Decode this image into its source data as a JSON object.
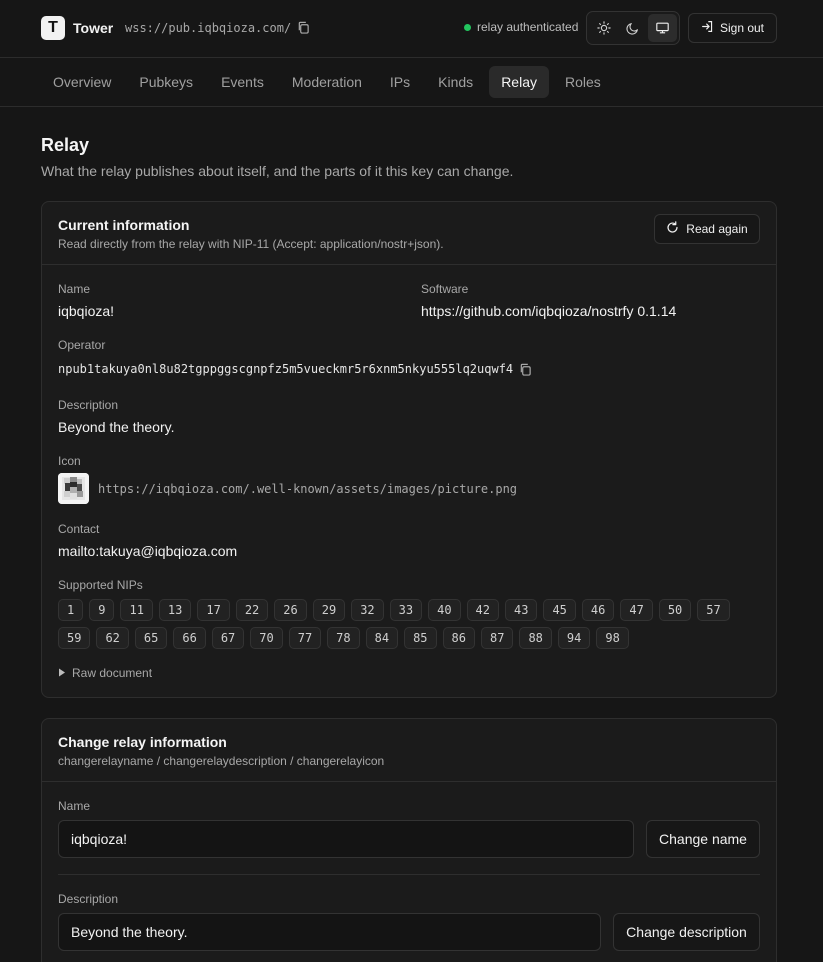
{
  "header": {
    "logo_glyph": "T",
    "app_name": "Tower",
    "relay_url": "wss://pub.iqbqioza.com/",
    "status_text": "relay authenticated",
    "status_color": "#22c55e",
    "theme_options": [
      "sun-icon",
      "moon-icon",
      "monitor-icon"
    ],
    "sign_out_label": "Sign out"
  },
  "nav": {
    "tabs": [
      {
        "label": "Overview"
      },
      {
        "label": "Pubkeys"
      },
      {
        "label": "Events"
      },
      {
        "label": "Moderation"
      },
      {
        "label": "IPs"
      },
      {
        "label": "Kinds"
      },
      {
        "label": "Relay"
      },
      {
        "label": "Roles"
      }
    ],
    "active": "Relay"
  },
  "page": {
    "title": "Relay",
    "subtitle": "What the relay publishes about itself, and the parts of it this key can change."
  },
  "current_info": {
    "title": "Current information",
    "description": "Read directly from the relay with NIP-11 (Accept: application/nostr+json).",
    "read_again_label": "Read again",
    "name_label": "Name",
    "name_value": "iqbqioza!",
    "software_label": "Software",
    "software_value": "https://github.com/iqbqioza/nostrfy 0.1.14",
    "operator_label": "Operator",
    "operator_value": "npub1takuya0nl8u82tgppggscgnpfz5m5vueckmr5r6xnm5nkyu555lq2uqwf4",
    "description_label": "Description",
    "description_value": "Beyond the theory.",
    "icon_label": "Icon",
    "icon_url": "https://iqbqioza.com/.well-known/assets/images/picture.png",
    "contact_label": "Contact",
    "contact_value": "mailto:takuya@iqbqioza.com",
    "nips_label": "Supported NIPs",
    "nips": [
      "1",
      "9",
      "11",
      "13",
      "17",
      "22",
      "26",
      "29",
      "32",
      "33",
      "40",
      "42",
      "43",
      "45",
      "46",
      "47",
      "50",
      "57",
      "59",
      "62",
      "65",
      "66",
      "67",
      "70",
      "77",
      "78",
      "84",
      "85",
      "86",
      "87",
      "88",
      "94",
      "98"
    ],
    "raw_label": "Raw document"
  },
  "change_info": {
    "title": "Change relay information",
    "description": "changerelayname / changerelaydescription / changerelayicon",
    "name_label": "Name",
    "name_value": "iqbqioza!",
    "change_name_label": "Change name",
    "description_label": "Description",
    "description_value": "Beyond the theory.",
    "change_description_label": "Change description"
  }
}
